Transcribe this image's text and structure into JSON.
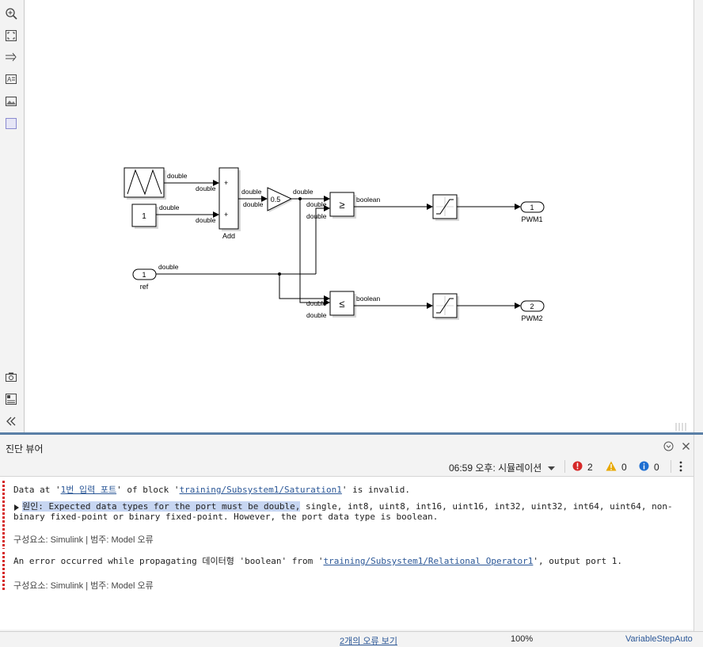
{
  "toolbar": {
    "icons": [
      "zoom-in-icon",
      "fit-view-icon",
      "arrow-icon",
      "annotation-icon",
      "image-icon",
      "area-icon",
      "camera-icon",
      "property-inspector-icon",
      "collapse-icon"
    ]
  },
  "diagram": {
    "sig_double": "double",
    "sig_boolean": "boolean",
    "constant_value": "1",
    "sum_plus": "+",
    "sum_label": "Add",
    "gain_value": "0.5",
    "ge_symbol": "≥",
    "le_symbol": "≤",
    "inport_ref_num": "1",
    "inport_ref_label": "ref",
    "outport1_num": "1",
    "outport1_label": "PWM1",
    "outport2_num": "2",
    "outport2_label": "PWM2"
  },
  "diagnostic_viewer": {
    "title": "진단 뷰어",
    "time_label": "06:59 오후: 시뮬레이션",
    "error_count": "2",
    "warning_count": "0",
    "info_count": "0",
    "msg1": {
      "pre1": "Data at '",
      "link1": "1번 입력 포트",
      "mid1": "' of block '",
      "link2": "training/Subsystem1/Saturation1",
      "post1": "' is invalid.",
      "cause_highlight": "원인: Expected data types for the port must be double,",
      "cause_rest": " single, int8, uint8, int16, uint16, int32, uint32, int64, uint64, non-",
      "cause_line2": "binary fixed-point or binary fixed-point. However, the port data type is boolean.",
      "meta": "구성요소: Simulink | 범주: Model 오류"
    },
    "msg2": {
      "pre": "An error occurred while propagating 데이터형 'boolean' from '",
      "link": "training/Subsystem1/Relational Operator1",
      "post": "', output port 1.",
      "meta": "구성요소: Simulink | 범주: Model 오류"
    }
  },
  "statusbar": {
    "errors_link": "2개의 오류 보기",
    "zoom": "100%",
    "solver": "VariableStepAuto"
  },
  "colors": {
    "accent": "#2b5797",
    "error": "#d62828",
    "warning": "#e8a800",
    "info": "#1f6fd1",
    "selection": "#c7d6f2"
  }
}
